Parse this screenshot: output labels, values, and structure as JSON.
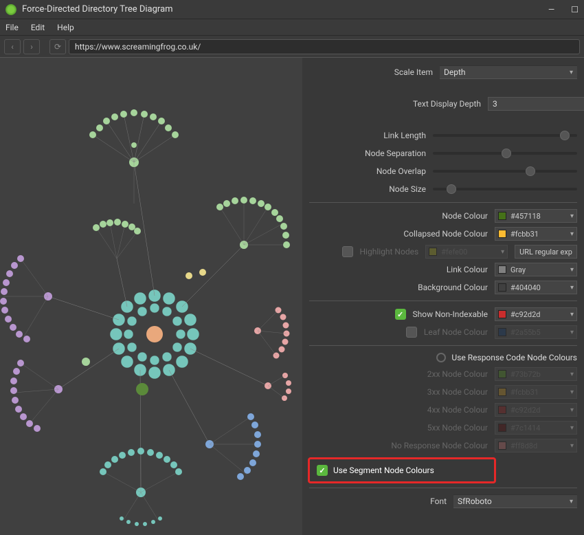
{
  "title": "Force-Directed Directory Tree Diagram",
  "menu": {
    "file": "File",
    "edit": "Edit",
    "help": "Help"
  },
  "url": "https://www.screamingfrog.co.uk/",
  "panel": {
    "scale_item_label": "Scale Item",
    "scale_item_value": "Depth",
    "text_depth_label": "Text Display Depth",
    "text_depth_value": "3",
    "link_length": "Link Length",
    "node_separation": "Node Separation",
    "node_overlap": "Node Overlap",
    "node_size": "Node Size",
    "node_colour_label": "Node Colour",
    "node_colour": "#457118",
    "collapsed_label": "Collapsed Node Colour",
    "collapsed_colour": "#fcbb31",
    "highlight_label": "Highlight Nodes",
    "highlight_colour": "#fefe00",
    "highlight_extra": "URL regular exp",
    "link_colour_label": "Link Colour",
    "link_colour_value": "Gray",
    "bg_label": "Background Colour",
    "bg_colour": "#404040",
    "show_nonindex_label": "Show Non-Indexable",
    "nonindex_colour": "#c92d2d",
    "leaf_label": "Leaf Node Colour",
    "leaf_colour": "#2a55b5",
    "use_response_label": "Use Response Code Node Colours",
    "c2xx_label": "2xx Node Colour",
    "c2xx": "#73b72b",
    "c3xx_label": "3xx Node Colour",
    "c3xx": "#fcbb31",
    "c4xx_label": "4xx Node Colour",
    "c4xx": "#c92d2d",
    "c5xx_label": "5xx Node Colour",
    "c5xx": "#7c1414",
    "cnone_label": "No Response Node Colour",
    "cnone": "#ff8d8d",
    "use_segment_label": "Use Segment Node Colours",
    "font_label": "Font",
    "font_value": "SfRoboto"
  }
}
